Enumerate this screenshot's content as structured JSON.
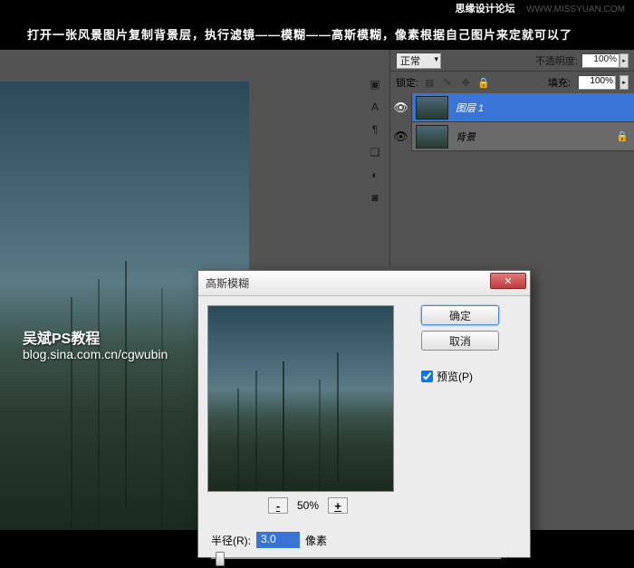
{
  "header": {
    "logo": "思缘设计论坛",
    "url": "WWW.MISSYUAN.COM"
  },
  "instruction": "打开一张风景图片复制背景层，执行滤镜——模糊——高斯模糊，像素根据自己图片来定就可以了",
  "watermark": {
    "main": "吴斌PS教程",
    "sub": "blog.sina.com.cn/cgwubin"
  },
  "toolbar": {
    "items": [
      "▣",
      "A",
      "¶",
      "❏",
      "◐",
      "◙"
    ]
  },
  "panel": {
    "blend_label": "正常",
    "opacity_label": "不透明度:",
    "opacity_value": "100%",
    "lock_label": "锁定:",
    "fill_label": "填充:",
    "fill_value": "100%",
    "lock_icons": [
      "▦",
      "✎",
      "✥",
      "🔒"
    ]
  },
  "layers": [
    {
      "name": "图层 1",
      "visible": true,
      "active": true,
      "locked": false
    },
    {
      "name": "背景",
      "visible": true,
      "active": false,
      "locked": true
    }
  ],
  "dialog": {
    "title": "高斯模糊",
    "ok": "确定",
    "cancel": "取消",
    "preview_label": "预览(P)",
    "preview_checked": true,
    "zoom_minus": "-",
    "zoom_value": "50%",
    "zoom_plus": "+",
    "radius_label": "半径(R):",
    "radius_value": "3.0",
    "radius_unit": "像素"
  }
}
